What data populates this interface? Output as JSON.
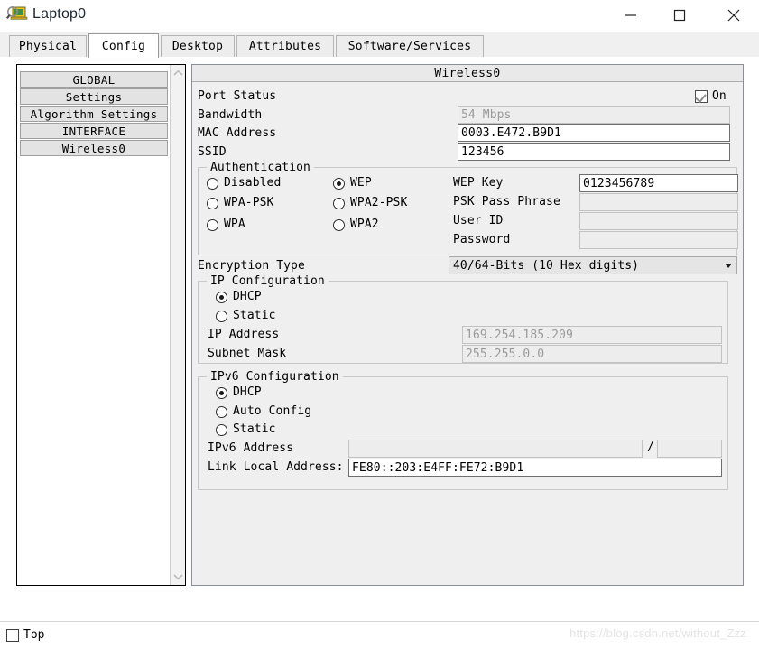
{
  "window": {
    "title": "Laptop0",
    "icon": "laptop-magnifier-icon",
    "minimize_label": "—",
    "maximize_label": "☐",
    "close_label": "✕"
  },
  "tabs": [
    {
      "label": "Physical",
      "active": false
    },
    {
      "label": "Config",
      "active": true
    },
    {
      "label": "Desktop",
      "active": false
    },
    {
      "label": "Attributes",
      "active": false
    },
    {
      "label": "Software/Services",
      "active": false
    }
  ],
  "sidebar": {
    "items": [
      {
        "label": "GLOBAL",
        "kind": "header"
      },
      {
        "label": "Settings",
        "kind": "item"
      },
      {
        "label": "Algorithm Settings",
        "kind": "item"
      },
      {
        "label": "INTERFACE",
        "kind": "header"
      },
      {
        "label": "Wireless0",
        "kind": "item"
      }
    ],
    "scroll_up_icon": "chevron-up-icon",
    "scroll_down_icon": "chevron-down-icon"
  },
  "panel": {
    "header": "Wireless0",
    "port_status": {
      "label": "Port Status",
      "checkbox_label": "On",
      "checked": true
    },
    "bandwidth": {
      "label": "Bandwidth",
      "value": "54 Mbps",
      "enabled": false
    },
    "mac_address": {
      "label": "MAC Address",
      "value": "0003.E472.B9D1",
      "enabled": true
    },
    "ssid": {
      "label": "SSID",
      "value": "123456",
      "enabled": true
    },
    "authentication": {
      "title": "Authentication",
      "options": [
        {
          "label": "Disabled",
          "selected": false
        },
        {
          "label": "WEP",
          "selected": true
        },
        {
          "label": "WPA-PSK",
          "selected": false
        },
        {
          "label": "WPA2-PSK",
          "selected": false
        },
        {
          "label": "WPA",
          "selected": false
        },
        {
          "label": "WPA2",
          "selected": false
        }
      ],
      "fields": [
        {
          "label": "WEP Key",
          "value": "0123456789",
          "enabled": true
        },
        {
          "label": "PSK Pass Phrase",
          "value": "",
          "enabled": false
        },
        {
          "label": "User ID",
          "value": "",
          "enabled": false
        },
        {
          "label": "Password",
          "value": "",
          "enabled": false
        }
      ]
    },
    "encryption_type": {
      "label": "Encryption Type",
      "selected": "40/64-Bits (10 Hex digits)",
      "arrow_icon": "chevron-down-icon"
    },
    "ip_configuration": {
      "title": "IP Configuration",
      "options": [
        {
          "label": "DHCP",
          "selected": true
        },
        {
          "label": "Static",
          "selected": false
        }
      ],
      "ip_address": {
        "label": "IP Address",
        "value": "169.254.185.209",
        "enabled": false
      },
      "subnet_mask": {
        "label": "Subnet Mask",
        "value": "255.255.0.0",
        "enabled": false
      }
    },
    "ipv6_configuration": {
      "title": "IPv6 Configuration",
      "options": [
        {
          "label": "DHCP",
          "selected": true
        },
        {
          "label": "Auto Config",
          "selected": false
        },
        {
          "label": "Static",
          "selected": false
        }
      ],
      "ipv6_address": {
        "label": "IPv6 Address",
        "value": "",
        "separator": "/",
        "prefix": "",
        "enabled": false
      },
      "link_local": {
        "label": "Link Local Address:",
        "value": "FE80::203:E4FF:FE72:B9D1",
        "enabled": true
      }
    }
  },
  "statusbar": {
    "top_label": "Top",
    "top_checked": false,
    "watermark": "https://blog.csdn.net/without_Zzz"
  }
}
